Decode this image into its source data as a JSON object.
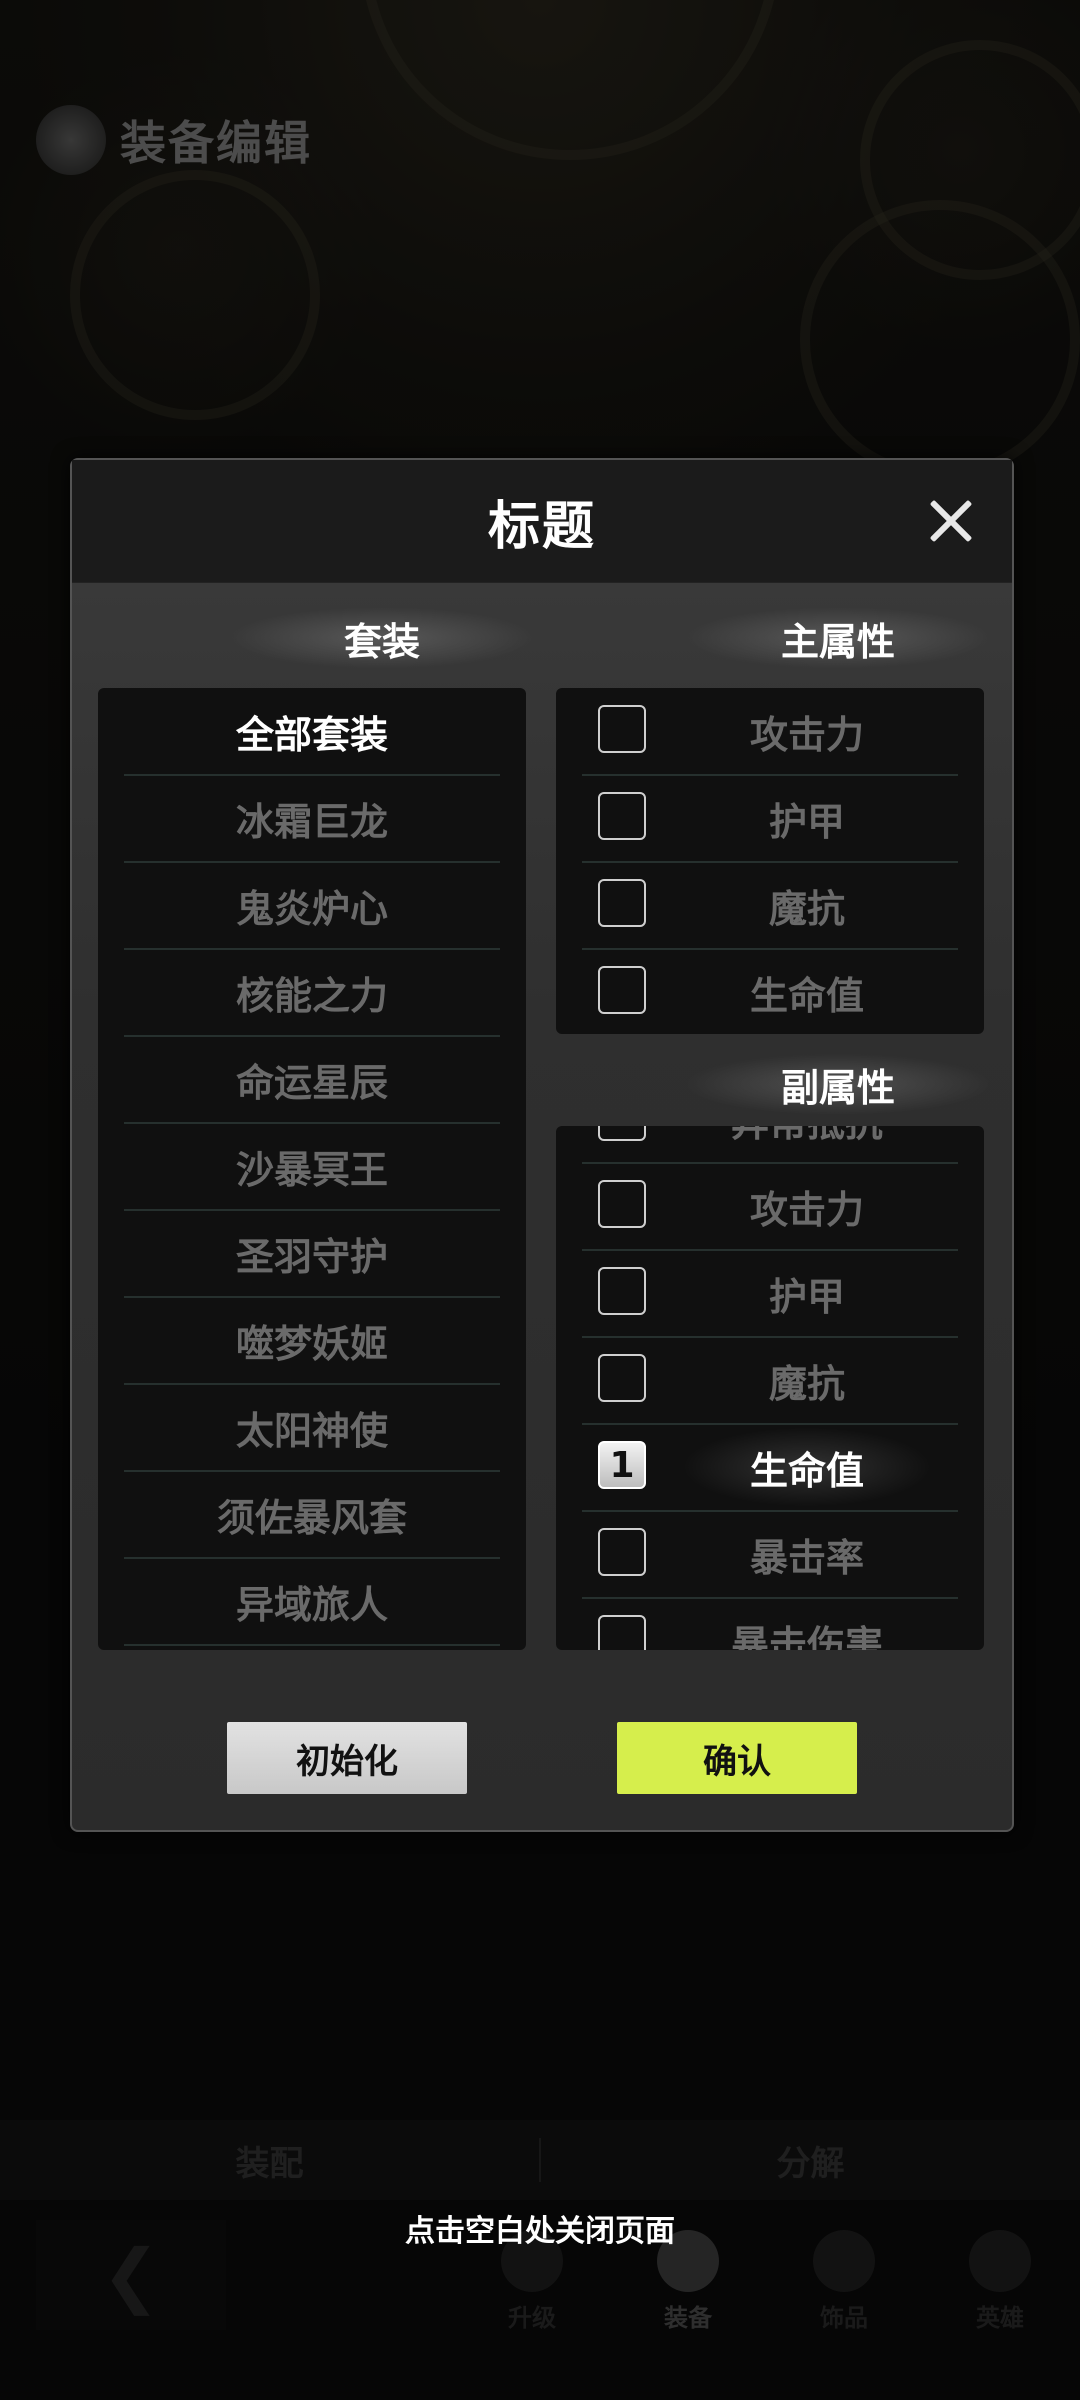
{
  "page": {
    "title": "装备编辑"
  },
  "bottom_tabs": {
    "assemble": "装配",
    "dismantle": "分解"
  },
  "close_hint": "点击空白处关闭页面",
  "nav": {
    "upgrade": "升级",
    "equipment": "装备",
    "accessory": "饰品",
    "hero": "英雄"
  },
  "modal": {
    "title": "标题",
    "set_heading": "套装",
    "main_attr_heading": "主属性",
    "sub_attr_heading": "副属性",
    "sets": [
      "全部套装",
      "冰霜巨龙",
      "鬼炎炉心",
      "核能之力",
      "命运星辰",
      "沙暴冥王",
      "圣羽守护",
      "噬梦妖姬",
      "太阳神使",
      "须佐暴风套",
      "异域旅人"
    ],
    "selected_set": "全部套装",
    "main_attrs": [
      "攻击力",
      "护甲",
      "魔抗",
      "生命值"
    ],
    "sub_attrs": [
      "异常抵抗",
      "攻击力",
      "护甲",
      "魔抗",
      "生命值",
      "暴击率",
      "暴击伤害"
    ],
    "sub_selected": {
      "label": "生命值",
      "order": "1"
    },
    "reset_label": "初始化",
    "confirm_label": "确认"
  },
  "colors": {
    "confirm": "#d6ee4c",
    "accent_text": "#ffffff"
  }
}
